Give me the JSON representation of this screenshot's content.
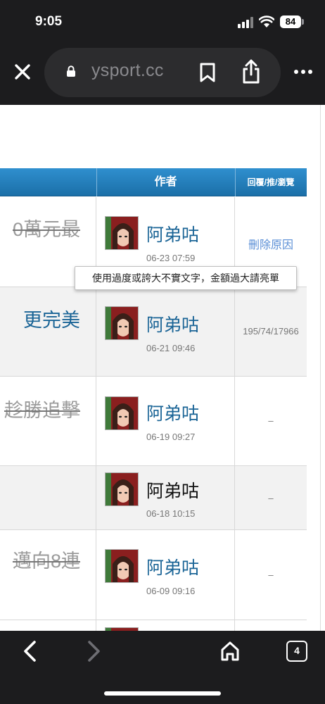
{
  "status": {
    "time": "9:05",
    "battery": "84"
  },
  "browser": {
    "url_main": "ysport.cc",
    "icons": [
      "close-icon",
      "lock-icon",
      "bookmark-icon",
      "share-icon",
      "more-icon",
      "back-icon",
      "forward-icon",
      "home-icon"
    ],
    "tab_count": "4"
  },
  "table": {
    "header": {
      "author": "作者",
      "stats": "回覆/推/瀏覽"
    },
    "rows": [
      {
        "title": "0萬元最",
        "title_style": "struck",
        "author": "阿弟咕",
        "date": "06-23 07:59",
        "stats": "刪除原因",
        "stats_is_link": true
      },
      {
        "title": "更完美",
        "title_style": "blue",
        "author": "阿弟咕",
        "date": "06-21 09:46",
        "stats": "195/74/17966"
      },
      {
        "title": "趁勝追擊",
        "title_style": "struck",
        "author": "阿弟咕",
        "date": "06-19 09:27",
        "stats": "–"
      },
      {
        "title": "",
        "title_style": "plain",
        "author": "阿弟咕",
        "date": "06-18 10:15",
        "stats": "–"
      },
      {
        "title": "邁向8連",
        "title_style": "struck",
        "author": "阿弟咕",
        "date": "06-09 09:16",
        "stats": "–"
      }
    ]
  },
  "tooltip": "使用過度或誇大不實文字，金額過大請亮單",
  "colors": {
    "header_blue": "#2f8fcf",
    "link_blue": "#1a6496",
    "row_gray": "#f2f2f2",
    "toolbar": "#1c1c1e"
  }
}
